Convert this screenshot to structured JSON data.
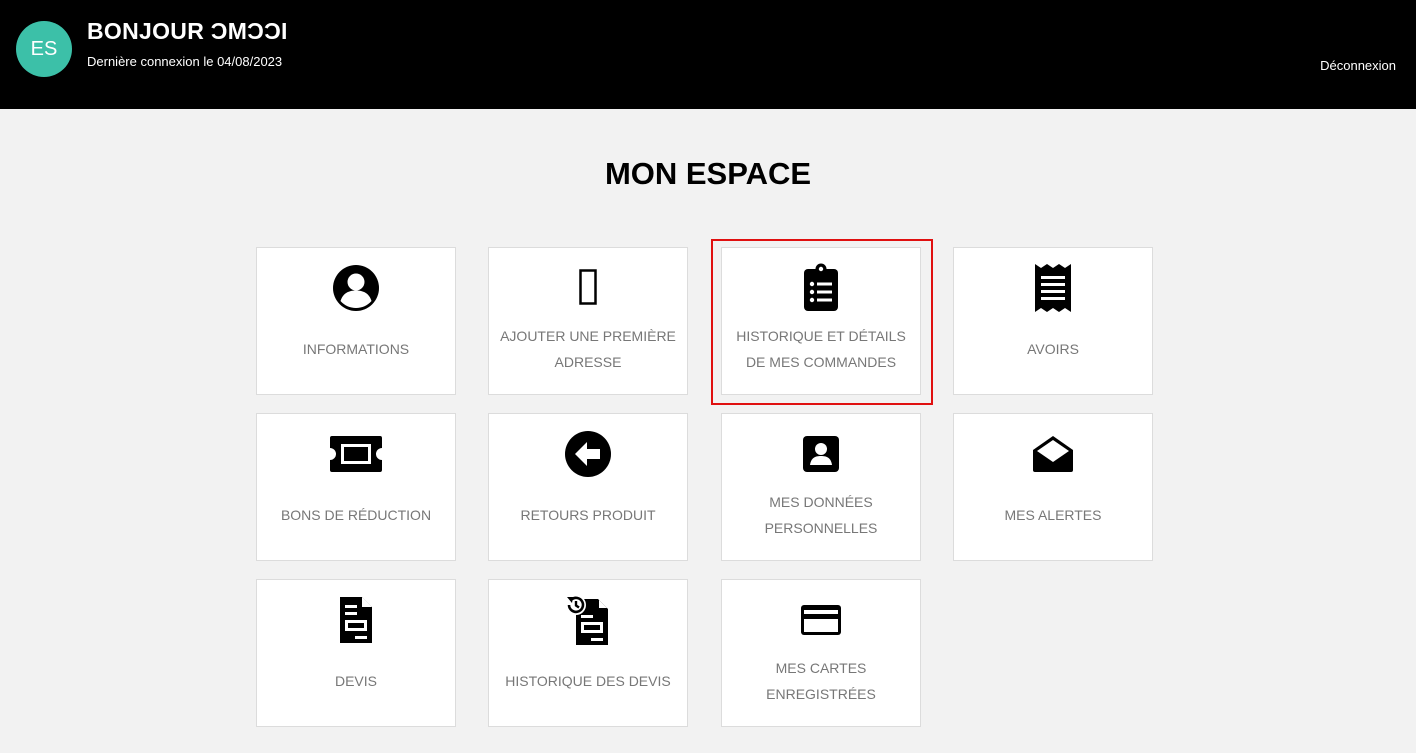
{
  "header": {
    "avatar_initials": "ES",
    "greeting": "BONJOUR ƆMƆƆI",
    "last_login": "Dernière connexion le 04/08/2023",
    "logout_label": "Déconnexion"
  },
  "page_title": "MON ESPACE",
  "tiles": [
    {
      "label": "INFORMATIONS",
      "icon": "user-circle-icon"
    },
    {
      "label": "AJOUTER UNE PREMIÈRE ADRESSE",
      "icon": "missing-glyph-icon"
    },
    {
      "label": "HISTORIQUE ET DÉTAILS DE MES COMMANDES",
      "icon": "clipboard-list-icon"
    },
    {
      "label": "AVOIRS",
      "icon": "receipt-icon"
    },
    {
      "label": "BONS DE RÉDUCTION",
      "icon": "ticket-icon"
    },
    {
      "label": "RETOURS PRODUIT",
      "icon": "arrow-left-circle-icon"
    },
    {
      "label": "MES DONNÉES PERSONNELLES",
      "icon": "contact-card-icon"
    },
    {
      "label": "MES ALERTES",
      "icon": "envelope-open-icon"
    },
    {
      "label": "DEVIS",
      "icon": "quote-document-icon"
    },
    {
      "label": "HISTORIQUE DES DEVIS",
      "icon": "quote-history-icon"
    },
    {
      "label": "MES CARTES ENREGISTRÉES",
      "icon": "credit-card-icon"
    }
  ],
  "colors": {
    "header_bg": "#000000",
    "avatar_bg": "#3cc0a8",
    "page_bg": "#f2f2f2",
    "tile_label": "#777777",
    "highlight": "#e01010"
  }
}
